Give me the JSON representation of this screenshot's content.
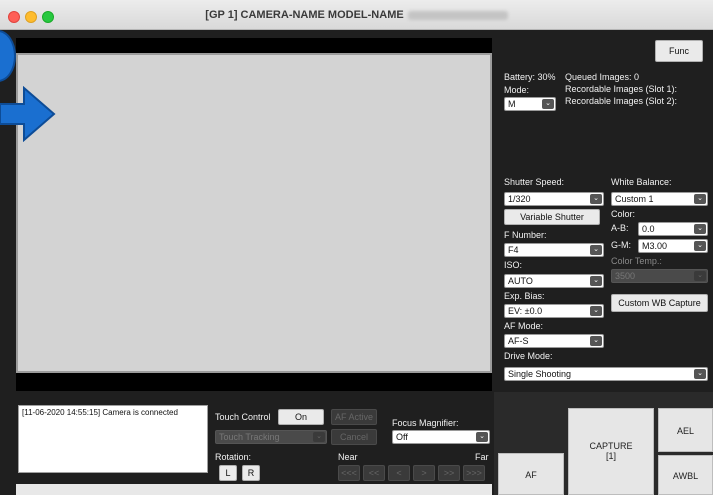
{
  "window": {
    "title": "[GP 1] CAMERA-NAME MODEL-NAME"
  },
  "status": {
    "battery": "Battery: 30%",
    "queued": "Queued Images: 0",
    "mode_label": "Mode:",
    "slot1": "Recordable Images (Slot 1):",
    "slot2": "Recordable Images (Slot 2):"
  },
  "func_label": "Func",
  "mode_value": "M",
  "shutter": {
    "label": "Shutter Speed:",
    "value": "1/320",
    "variable_button": "Variable Shutter"
  },
  "fnumber": {
    "label": "F Number:",
    "value": "F4"
  },
  "iso": {
    "label": "ISO:",
    "value": "AUTO"
  },
  "exp_bias": {
    "label": "Exp. Bias:",
    "value": "EV: ±0.0"
  },
  "af_mode": {
    "label": "AF Mode:",
    "value": "AF-S"
  },
  "drive_mode": {
    "label": "Drive Mode:",
    "value": "Single Shooting"
  },
  "white_balance": {
    "label": "White Balance:",
    "value": "Custom 1",
    "color_label": "Color:",
    "ab_label": "A-B:",
    "ab_value": "0.0",
    "gm_label": "G-M:",
    "gm_value": "M3.00",
    "temp_label": "Color Temp.:",
    "temp_value": "3500",
    "capture_button": "Custom WB Capture"
  },
  "log": {
    "line": "[11-06-2020 14:55:15] Camera is connected"
  },
  "touch": {
    "control_label": "Touch Control",
    "on_button": "On",
    "af_active": "AF Active",
    "tracking": "Touch Tracking",
    "cancel": "Cancel"
  },
  "focus_magnifier": {
    "label": "Focus Magnifier:",
    "value": "Off"
  },
  "rotation": {
    "label": "Rotation:",
    "left": "L",
    "right": "R"
  },
  "focus": {
    "near": "Near",
    "far": "Far",
    "steps": [
      "<<<",
      "<<",
      "<",
      ">",
      ">>",
      ">>>"
    ]
  },
  "buttons": {
    "af": "AF",
    "capture": "CAPTURE",
    "capture_count": "[1]",
    "ael": "AEL",
    "awbl": "AWBL"
  },
  "colors": {
    "accent_arrow": "#1a6fd0",
    "preview_bg": "#d3d3d3",
    "panel_bg": "#1f1f1f"
  }
}
